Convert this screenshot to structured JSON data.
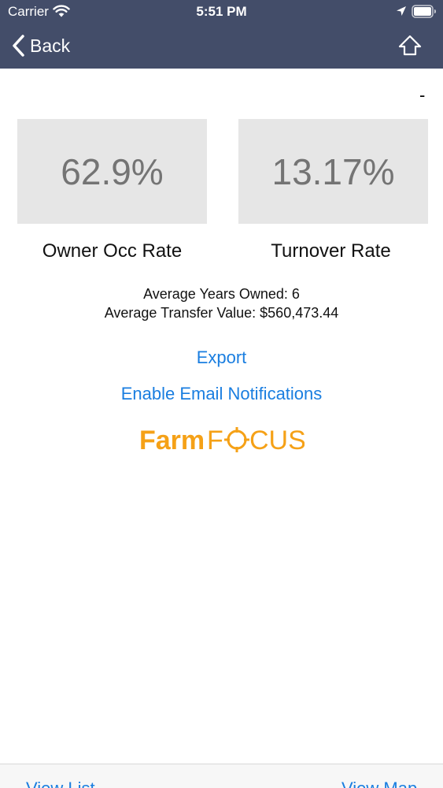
{
  "status_bar": {
    "carrier": "Carrier",
    "time": "5:51 PM",
    "icons": [
      "wifi-icon",
      "location-icon",
      "battery-icon"
    ]
  },
  "nav": {
    "back_label": "Back",
    "home_icon": "home-icon",
    "background_color": "#434d69"
  },
  "header_dash": "-",
  "stats": [
    {
      "value": "62.9%",
      "label": "Owner Occ Rate"
    },
    {
      "value": "13.17%",
      "label": "Turnover Rate"
    }
  ],
  "summary": {
    "years_owned": "Average Years Owned: 6",
    "transfer_value": "Average Transfer Value: $560,473.44"
  },
  "actions": {
    "export": "Export",
    "email_notifications": "Enable Email Notifications"
  },
  "logo": {
    "text_part1": "Farm",
    "text_part2": "F",
    "text_part3": "CUS",
    "brand_color": "#f5a117"
  },
  "toolbar": {
    "left_label": "View List",
    "right_label": "View Map"
  },
  "colors": {
    "link": "#1a7ee0",
    "card": "#e6e6e6",
    "card_text": "#747474"
  }
}
